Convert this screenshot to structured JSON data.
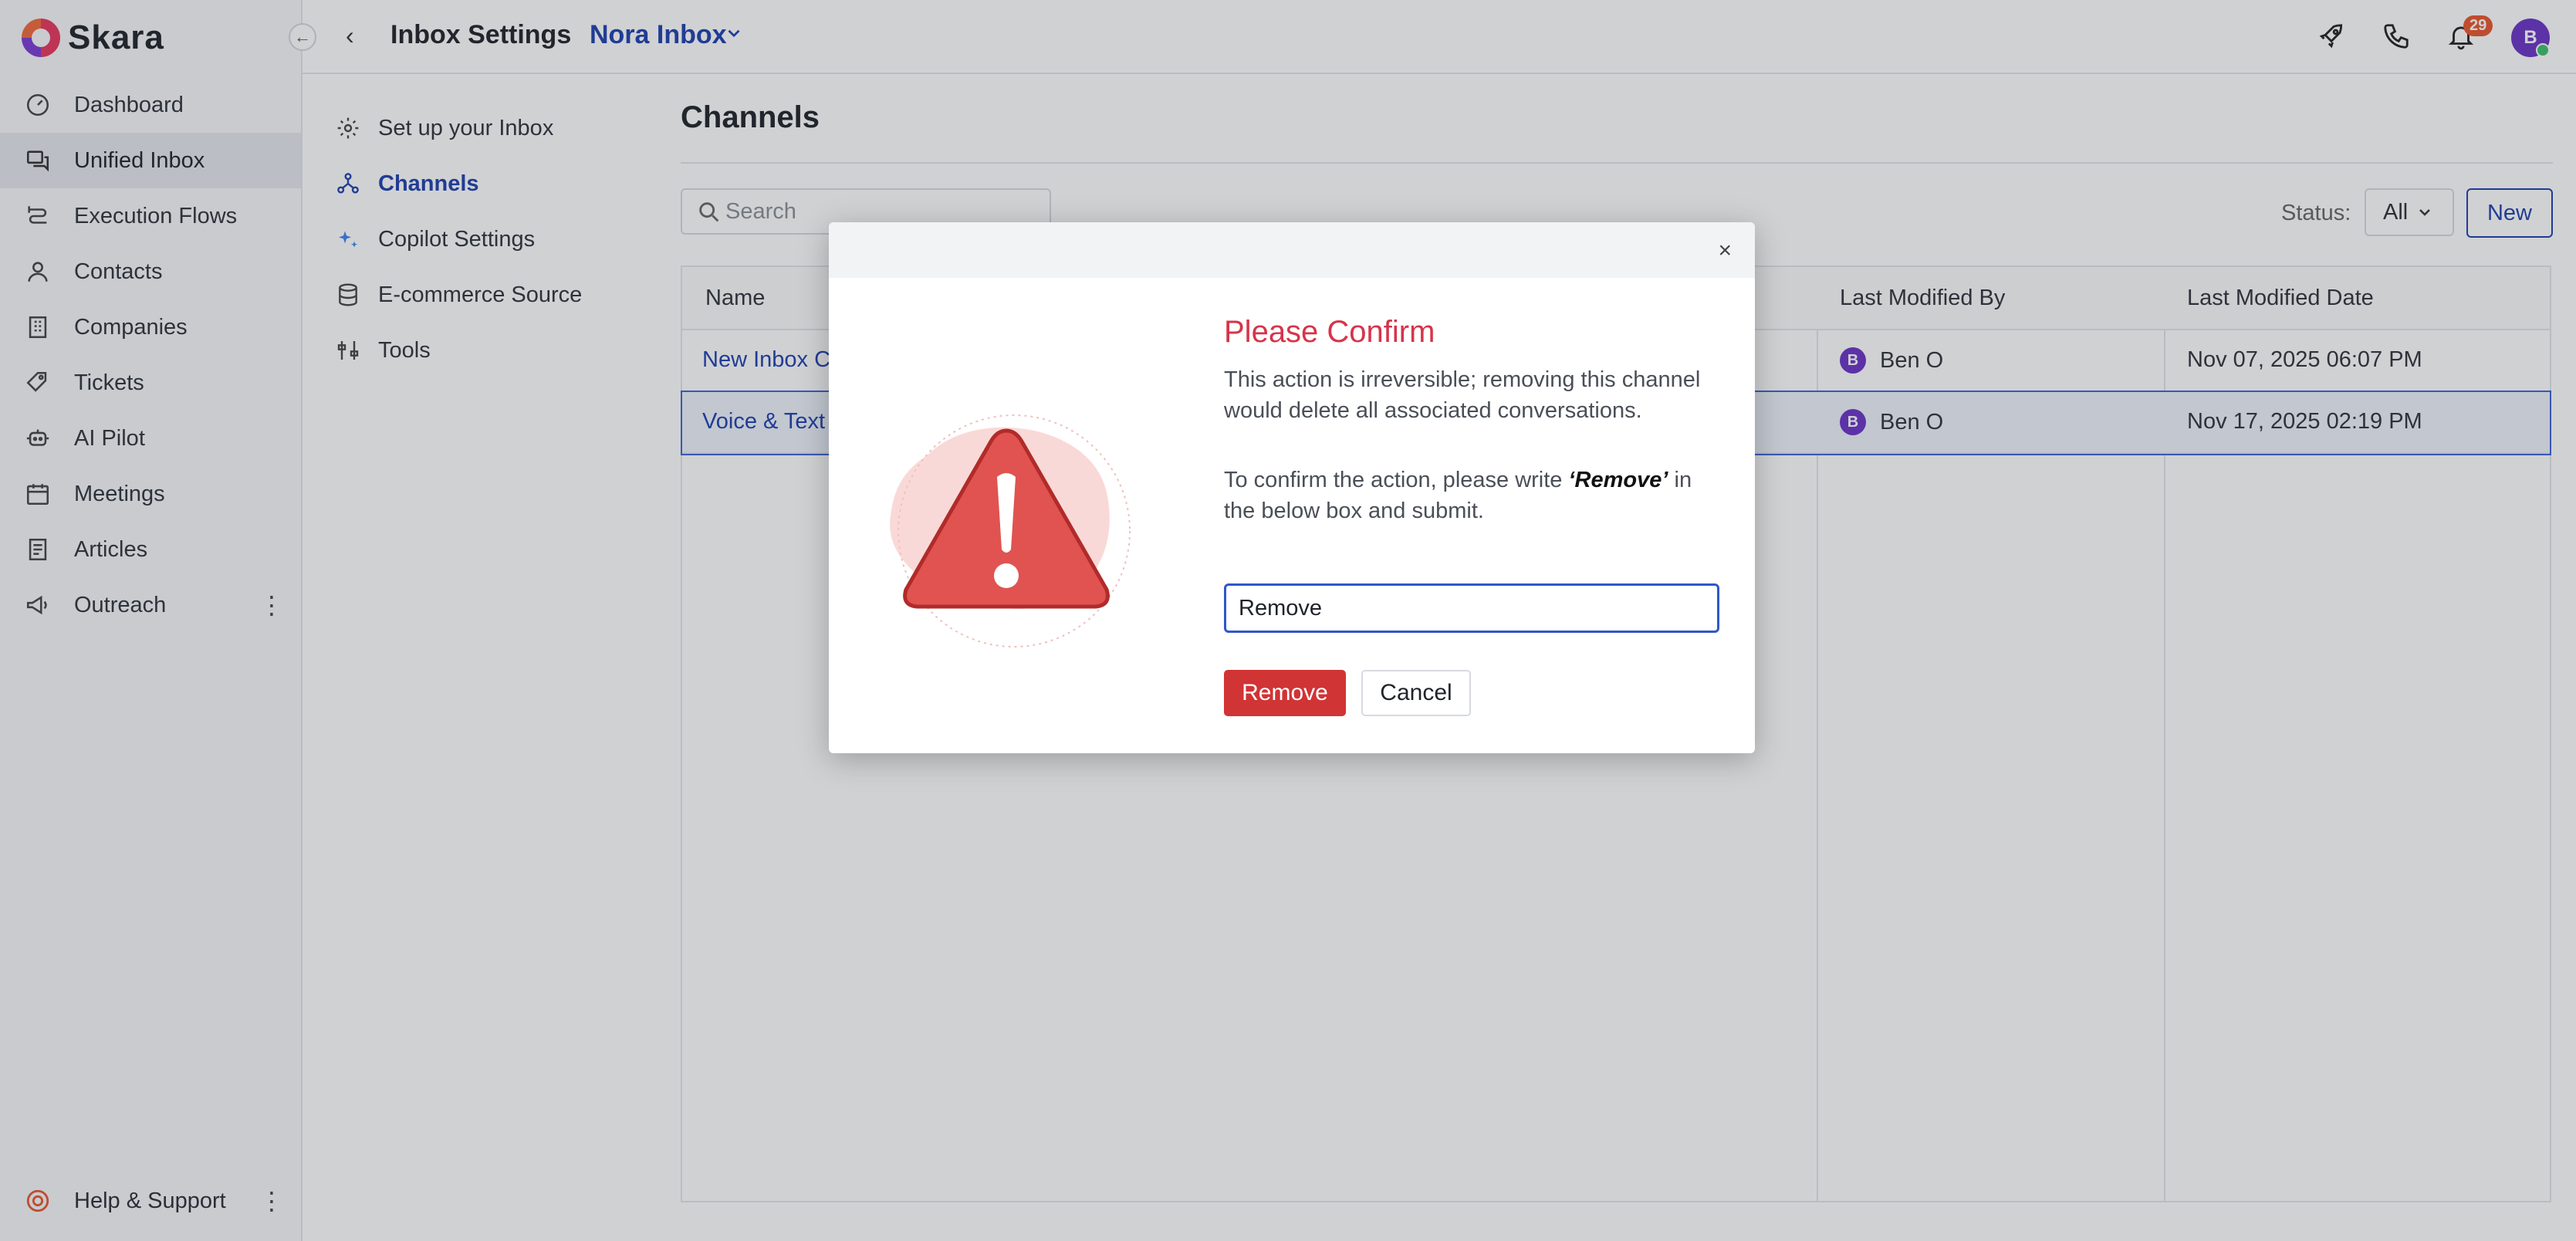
{
  "app": {
    "name": "Skara"
  },
  "sidebar": {
    "items": [
      {
        "label": "Dashboard",
        "icon": "dashboard-icon"
      },
      {
        "label": "Unified Inbox",
        "icon": "inbox-icon",
        "active": true
      },
      {
        "label": "Execution Flows",
        "icon": "flows-icon"
      },
      {
        "label": "Contacts",
        "icon": "contacts-icon"
      },
      {
        "label": "Companies",
        "icon": "companies-icon"
      },
      {
        "label": "Tickets",
        "icon": "ticket-icon"
      },
      {
        "label": "AI Pilot",
        "icon": "robot-icon"
      },
      {
        "label": "Meetings",
        "icon": "calendar-icon"
      },
      {
        "label": "Articles",
        "icon": "articles-icon"
      },
      {
        "label": "Outreach",
        "icon": "megaphone-icon"
      }
    ],
    "help_label": "Help & Support"
  },
  "topbar": {
    "title": "Inbox Settings",
    "inbox_name": "Nora Inbox",
    "notification_count": "29",
    "user_initial": "B"
  },
  "subnav": {
    "items": [
      {
        "label": "Set up your Inbox",
        "icon": "gear-icon"
      },
      {
        "label": "Channels",
        "icon": "channels-icon",
        "active": true
      },
      {
        "label": "Copilot Settings",
        "icon": "sparkle-icon"
      },
      {
        "label": "E-commerce Source",
        "icon": "database-icon"
      },
      {
        "label": "Tools",
        "icon": "tools-icon"
      }
    ]
  },
  "main": {
    "title": "Channels",
    "search_placeholder": "Search",
    "status_label": "Status:",
    "status_value": "All",
    "new_label": "New",
    "table": {
      "headers": [
        "Name",
        "Last Modified By",
        "Last Modified Date"
      ],
      "rows": [
        {
          "name": "New Inbox C",
          "modified_by": "Ben O",
          "modified_by_initial": "B",
          "modified_date": "Nov 07, 2025 06:07 PM"
        },
        {
          "name": "Voice & Text",
          "modified_by": "Ben O",
          "modified_by_initial": "B",
          "modified_date": "Nov 17, 2025 02:19 PM",
          "selected": true
        }
      ]
    }
  },
  "modal": {
    "close_glyph": "×",
    "title": "Please Confirm",
    "message": "This action is irreversible; removing this channel would delete all associated conversations.",
    "instruction_pre": "To confirm the action, please write ",
    "instruction_keyword": "‘Remove’",
    "instruction_post": " in the below box and submit.",
    "input_value": "Remove",
    "remove_label": "Remove",
    "cancel_label": "Cancel"
  },
  "colors": {
    "accent": "#1e40af",
    "danger": "#d03434",
    "title_red": "#d6344a",
    "avatar": "#6b34c7"
  }
}
